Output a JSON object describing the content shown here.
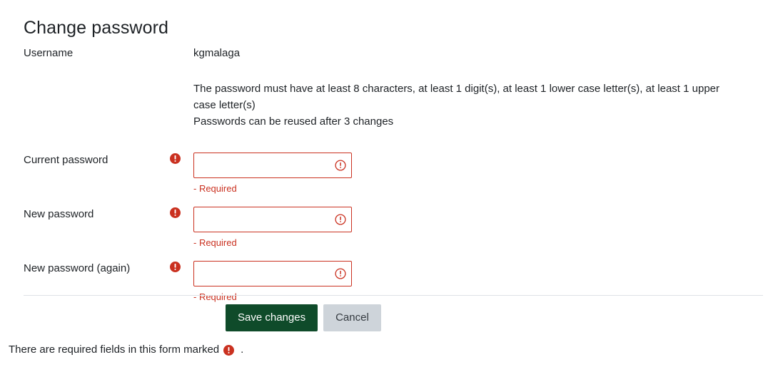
{
  "page": {
    "title": "Change password"
  },
  "form": {
    "username": {
      "label": "Username",
      "value": "kgmalaga"
    },
    "policy": {
      "requirements": "The password must have at least 8 characters, at least 1 digit(s), at least 1 lower case letter(s), at least 1 upper case letter(s)",
      "reuse": "Passwords can be reused after 3 changes"
    },
    "fields": [
      {
        "label": "Current password",
        "value": "",
        "error": "- Required",
        "required_icon": "required-exclamation-icon",
        "invalid_icon": "invalid-exclamation-icon"
      },
      {
        "label": "New password",
        "value": "",
        "error": "- Required",
        "required_icon": "required-exclamation-icon",
        "invalid_icon": "invalid-exclamation-icon"
      },
      {
        "label": "New password (again)",
        "value": "",
        "error": "- Required",
        "required_icon": "required-exclamation-icon",
        "invalid_icon": "invalid-exclamation-icon"
      }
    ]
  },
  "actions": {
    "save_label": "Save changes",
    "cancel_label": "Cancel"
  },
  "footer": {
    "text_before": "There are required fields in this form marked",
    "icon": "required-exclamation-icon",
    "text_after": "."
  },
  "colors": {
    "primary_button": "#0f4b2a",
    "secondary_button": "#ced4da",
    "required_red": "#ca3120",
    "text": "#1d2125",
    "divider": "#dee2e6"
  }
}
